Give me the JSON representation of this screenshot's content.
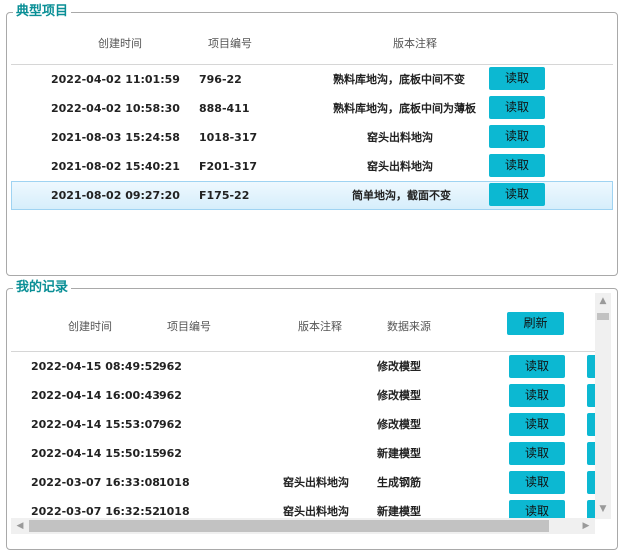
{
  "typical": {
    "title": "典型项目",
    "headers": {
      "created": "创建时间",
      "project_no": "项目编号",
      "note": "版本注释"
    },
    "rows": [
      {
        "created": "2022-04-02 11:01:59",
        "project_no": "796-22",
        "note": "熟料库地沟，底板中间不变",
        "button": "读取"
      },
      {
        "created": "2022-04-02 10:58:30",
        "project_no": "888-411",
        "note": "熟料库地沟，底板中间为薄板",
        "button": "读取"
      },
      {
        "created": "2021-08-03 15:24:58",
        "project_no": "1018-317",
        "note": "窑头出料地沟",
        "button": "读取"
      },
      {
        "created": "2021-08-02 15:40:21",
        "project_no": "F201-317",
        "note": "窑头出料地沟",
        "button": "读取"
      },
      {
        "created": "2021-08-02 09:27:20",
        "project_no": "F175-22",
        "note": "简单地沟，截面不变",
        "button": "读取"
      }
    ]
  },
  "records": {
    "title": "我的记录",
    "headers": {
      "created": "创建时间",
      "project_no": "项目编号",
      "note": "版本注释",
      "source": "数据来源"
    },
    "refresh_label": "刷新",
    "rows": [
      {
        "created": "2022-04-15 08:49:52",
        "project_no": "962",
        "note": "",
        "source": "修改模型",
        "button": "读取"
      },
      {
        "created": "2022-04-14 16:00:43",
        "project_no": "962",
        "note": "",
        "source": "修改模型",
        "button": "读取"
      },
      {
        "created": "2022-04-14 15:53:07",
        "project_no": "962",
        "note": "",
        "source": "修改模型",
        "button": "读取"
      },
      {
        "created": "2022-04-14 15:50:15",
        "project_no": "962",
        "note": "",
        "source": "新建模型",
        "button": "读取"
      },
      {
        "created": "2022-03-07 16:33:08",
        "project_no": "1018",
        "note": "窑头出料地沟",
        "source": "生成钢筋",
        "button": "读取"
      },
      {
        "created": "2022-03-07 16:32:52",
        "project_no": "1018",
        "note": "窑头出料地沟",
        "source": "新建模型",
        "button": "读取"
      }
    ]
  },
  "colors": {
    "accent": "#0a8f96",
    "button": "#0cb8d2",
    "selected_row": "#d6eefb"
  },
  "icons": {
    "scroll_up": "arrow-up-icon",
    "scroll_down": "arrow-down-icon",
    "scroll_left": "arrow-left-icon",
    "scroll_right": "arrow-right-icon"
  }
}
